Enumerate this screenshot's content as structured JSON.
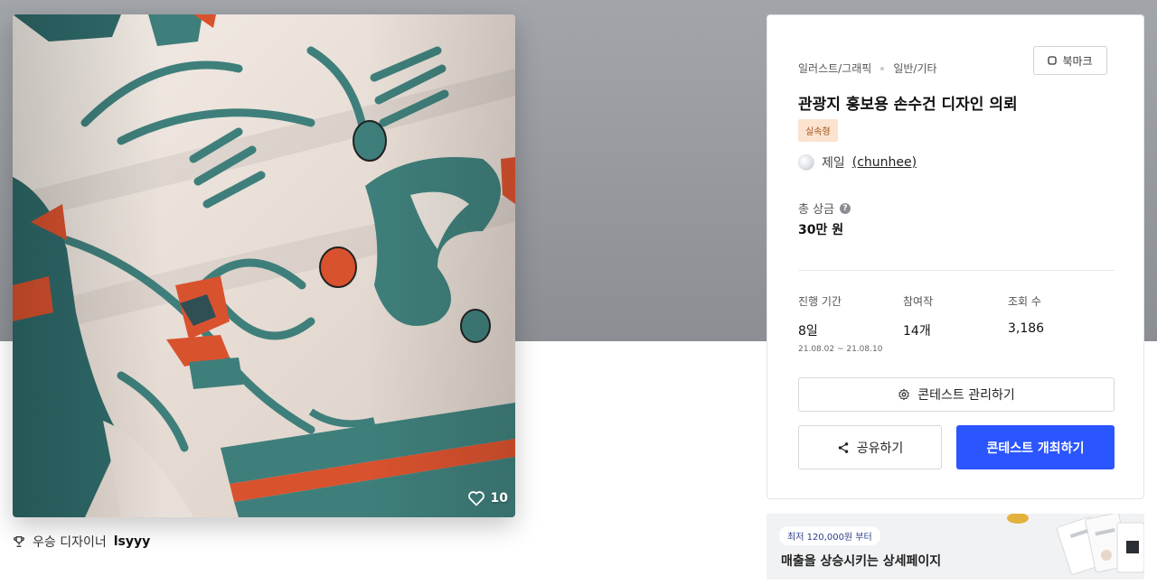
{
  "image": {
    "like_count": "10",
    "winner_label": "우승 디자이너",
    "winner_name": "lsyyy",
    "colors": {
      "fabric": "#ece4dd",
      "teal": "#3f7f7b",
      "orange": "#d9522e"
    }
  },
  "contest": {
    "category": "일러스트/그래픽",
    "subcategory": "일반/기타",
    "bookmark_label": "북마크",
    "title": "관광지 홍보용 손수건 디자인 의뢰",
    "type_badge": "실속형",
    "host_name": "제일",
    "host_handle": "(chunhee)",
    "prize_label": "총 상금",
    "prize_value": "30만 원",
    "stats": [
      {
        "label": "진행 기간",
        "value": "8일",
        "sub": "21.08.02 ~ 21.08.10"
      },
      {
        "label": "참여작",
        "value": "14개"
      },
      {
        "label": "조회 수",
        "value": "3,186"
      }
    ],
    "manage_button": "콘테스트 관리하기",
    "share_button": "공유하기",
    "host_button": "콘테스트 개최하기",
    "accent_color": "#2b55ff"
  },
  "ad": {
    "pill": "최저 120,000원 부터",
    "headline": "매출을 상승시키는 상세페이지"
  }
}
